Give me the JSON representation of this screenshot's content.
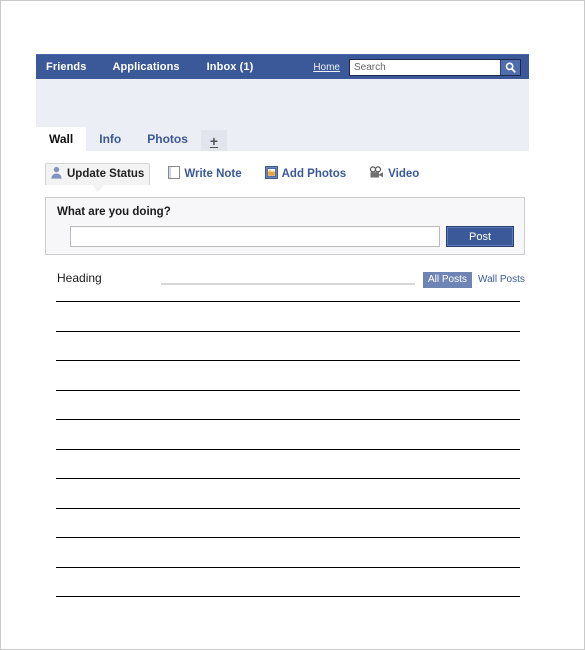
{
  "navbar": {
    "friends": "Friends",
    "applications": "Applications",
    "inbox": "Inbox (1)",
    "home": "Home",
    "search_placeholder": "Search",
    "search_value": "",
    "search_icon": "magnifier-icon",
    "bg_color": "#3b5998"
  },
  "tabs": [
    {
      "label": "Wall",
      "active": true
    },
    {
      "label": "Info",
      "active": false
    },
    {
      "label": "Photos",
      "active": false
    }
  ],
  "tab_add_label": "+",
  "actions": [
    {
      "label": "Update Status",
      "icon": "user-silhouette-icon",
      "active": true
    },
    {
      "label": "Write Note",
      "icon": "note-page-icon",
      "active": false
    },
    {
      "label": "Add Photos",
      "icon": "photo-frame-icon",
      "active": false
    },
    {
      "label": "Video",
      "icon": "movie-camera-icon",
      "active": false
    }
  ],
  "composer": {
    "prompt": "What are you doing?",
    "input_value": "",
    "input_placeholder": "",
    "post_label": "Post"
  },
  "feed": {
    "heading": "Heading",
    "filter_all": "All Posts",
    "filter_wall": "Wall Posts",
    "filter_all_bg": "#6d84b4",
    "line_count": 11
  },
  "colors": {
    "brand_blue": "#3b5998",
    "link_blue": "#3b5998",
    "band_lavender": "#eceef5",
    "composer_bg": "#f7f7f9"
  }
}
